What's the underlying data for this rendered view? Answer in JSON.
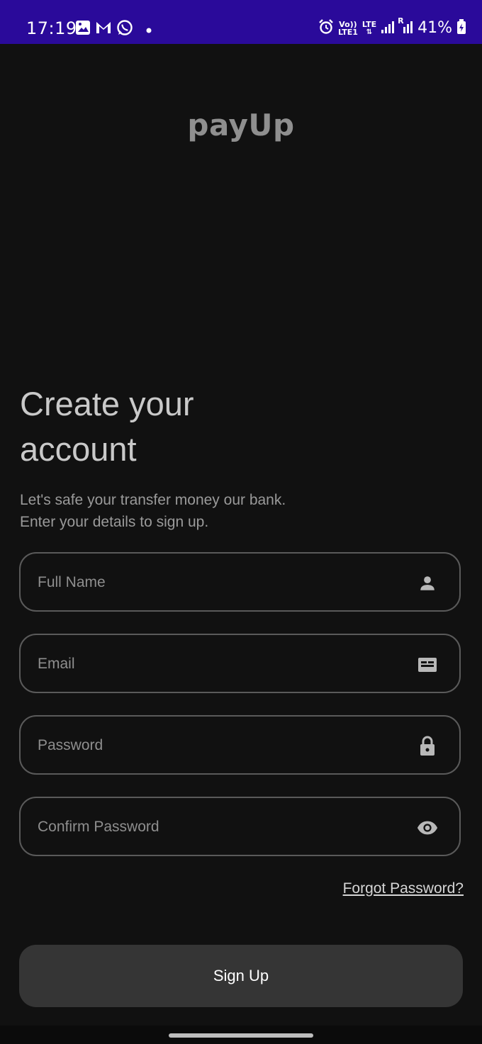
{
  "status_bar": {
    "time": "17:19",
    "network_label_top": "Vo))",
    "network_label_bottom": "LTE1",
    "lte_label": "LTE",
    "roaming_label": "R",
    "battery": "41%"
  },
  "logo": "payUp",
  "heading": {
    "line1": "Create your",
    "line2": "account"
  },
  "subtitle": {
    "line1": "Let's safe your transfer money our bank.",
    "line2": "Enter your details to sign up."
  },
  "form": {
    "full_name": {
      "placeholder": "Full Name",
      "value": "",
      "icon": "person-icon"
    },
    "email": {
      "placeholder": "Email",
      "value": "",
      "icon": "card-icon"
    },
    "password": {
      "placeholder": "Password",
      "value": "",
      "icon": "lock-icon"
    },
    "confirm_password": {
      "placeholder": "Confirm Password",
      "value": "",
      "icon": "eye-icon"
    }
  },
  "forgot_password": "Forgot Password?",
  "sign_up_button": "Sign Up",
  "colors": {
    "status_bar": "#2a0a9a",
    "background": "#111111",
    "button": "#353535",
    "field_border": "#5a5a5a"
  }
}
